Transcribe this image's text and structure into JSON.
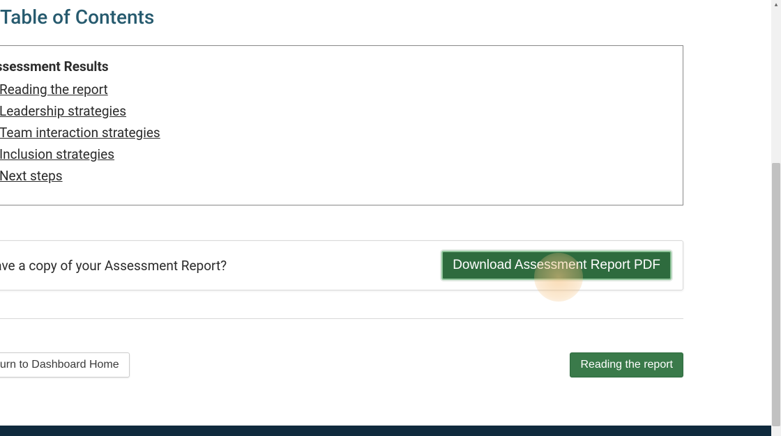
{
  "page": {
    "title": "Table of Contents"
  },
  "toc": {
    "heading": "Assessment Results",
    "items": [
      "Reading the report",
      "Leadership strategies",
      "Team interaction strategies",
      "Inclusion strategies",
      "Next steps"
    ]
  },
  "save_section": {
    "prompt": "Save a copy of your Assessment Report?",
    "button_label": "Download Assessment Report PDF"
  },
  "nav": {
    "return_label": "Return to Dashboard Home",
    "next_label": "Reading the report"
  }
}
